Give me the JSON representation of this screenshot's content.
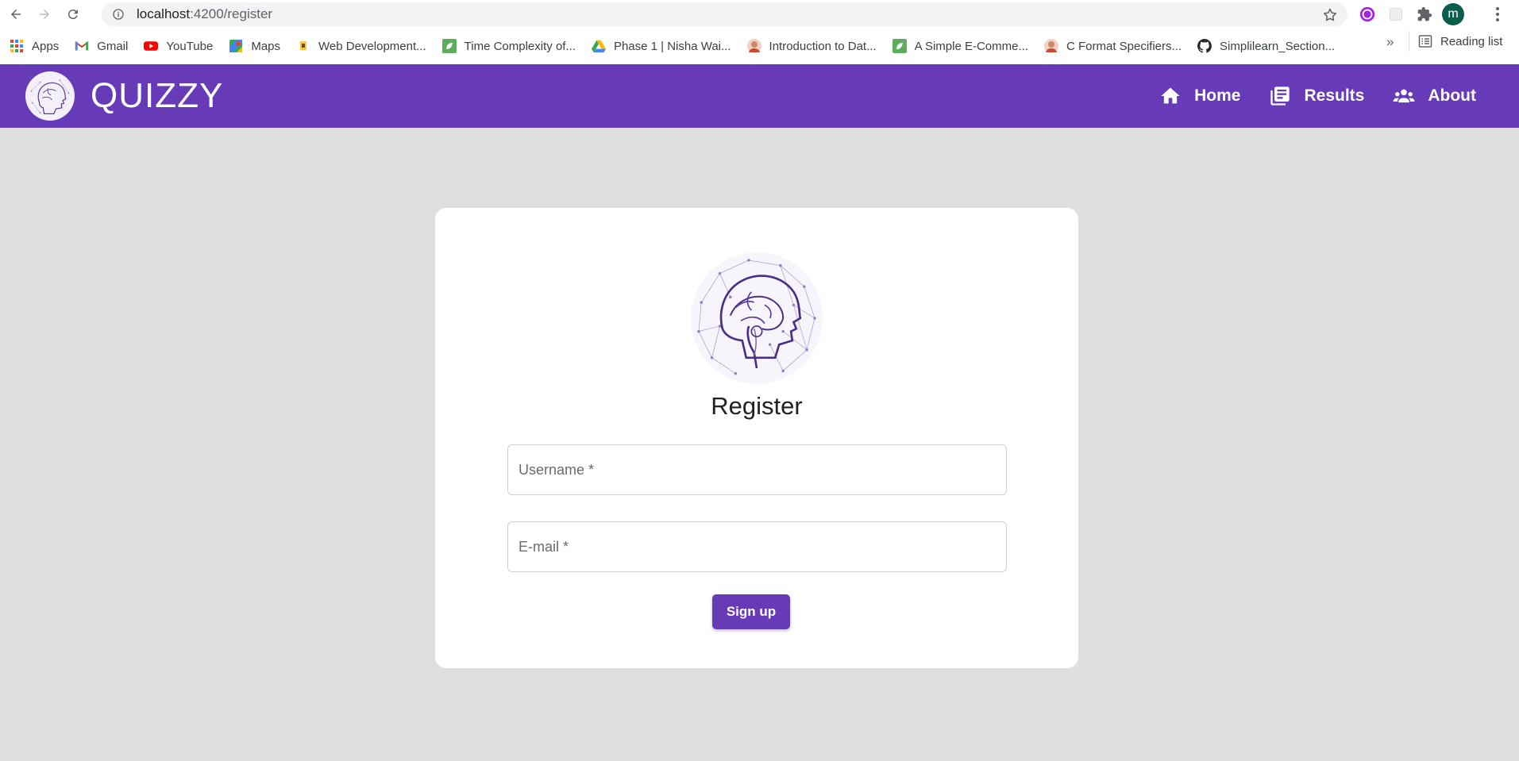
{
  "browser": {
    "url_host": "localhost",
    "url_path": ":4200/register",
    "profile_initial": "m",
    "bookmarks": [
      {
        "label": "Apps",
        "icon": "apps-grid-icon"
      },
      {
        "label": "Gmail",
        "icon": "gmail-icon"
      },
      {
        "label": "YouTube",
        "icon": "youtube-icon"
      },
      {
        "label": "Maps",
        "icon": "maps-icon"
      },
      {
        "label": "Web Development...",
        "icon": "bookmark-site-icon"
      },
      {
        "label": "Time Complexity of...",
        "icon": "leaf-icon"
      },
      {
        "label": "Phase 1 | Nisha Wai...",
        "icon": "google-drive-icon"
      },
      {
        "label": "Introduction to Dat...",
        "icon": "person-avatar-icon"
      },
      {
        "label": "A Simple E-Comme...",
        "icon": "leaf-icon"
      },
      {
        "label": "C Format Specifiers...",
        "icon": "person-avatar-icon"
      },
      {
        "label": "Simplilearn_Section...",
        "icon": "github-icon"
      }
    ],
    "more_bookmarks": "»",
    "reading_list": "Reading list"
  },
  "app": {
    "title": "QUIZZY",
    "nav": [
      {
        "label": "Home",
        "icon": "home-icon"
      },
      {
        "label": "Results",
        "icon": "results-icon"
      },
      {
        "label": "About",
        "icon": "people-icon"
      }
    ],
    "accent": "#673ab7"
  },
  "register": {
    "title": "Register",
    "username_placeholder": "Username *",
    "email_placeholder": "E-mail *",
    "submit_label": "Sign up"
  }
}
